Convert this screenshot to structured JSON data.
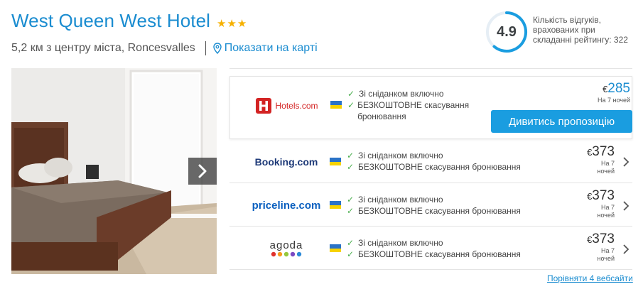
{
  "hotel": {
    "name": "West Queen West Hotel",
    "stars": "★★★",
    "distance": "5,2 км з центру міста, Roncesvalles",
    "map_link": "Показати на карті"
  },
  "rating": {
    "value": "4.9",
    "description": "Кількість відгуків, врахованих при складанні рейтингу: 322"
  },
  "offers": [
    {
      "provider": "Hotels.com",
      "amenity_1": "Зі сніданком включно",
      "amenity_2": "БЕЗКОШТОВНЕ скасування бронювання",
      "currency": "€",
      "price": "285",
      "nights": "На 7 ночей",
      "cta": "Дивитись пропозицію"
    },
    {
      "provider": "Booking.com",
      "amenity_1": "Зі сніданком включно",
      "amenity_2": "БЕЗКОШТОВНЕ скасування бронювання",
      "currency": "€",
      "price": "373",
      "nights_1": "На 7",
      "nights_2": "ночей"
    },
    {
      "provider": "priceline.com",
      "amenity_1": "Зі сніданком включно",
      "amenity_2": "БЕЗКОШТОВНЕ скасування бронювання",
      "currency": "€",
      "price": "373",
      "nights_1": "На 7",
      "nights_2": "ночей"
    },
    {
      "provider": "agoda",
      "amenity_1": "Зі сніданком включно",
      "amenity_2": "БЕЗКОШТОВНЕ скасування бронювання",
      "currency": "€",
      "price": "373",
      "nights_1": "На 7",
      "nights_2": "ночей"
    }
  ],
  "compare_link": "Порівняти 4 вебсайти",
  "icons": {
    "stars": "star-icon",
    "map": "map-pin-icon",
    "check": "check-icon",
    "chevron": "chevron-right-icon",
    "flag": "ukraine-flag-icon"
  },
  "colors": {
    "link": "#1a8cd0",
    "button": "#1a9de0",
    "star": "#f6b100",
    "check": "#4caf50",
    "hotels_red": "#d32323"
  }
}
